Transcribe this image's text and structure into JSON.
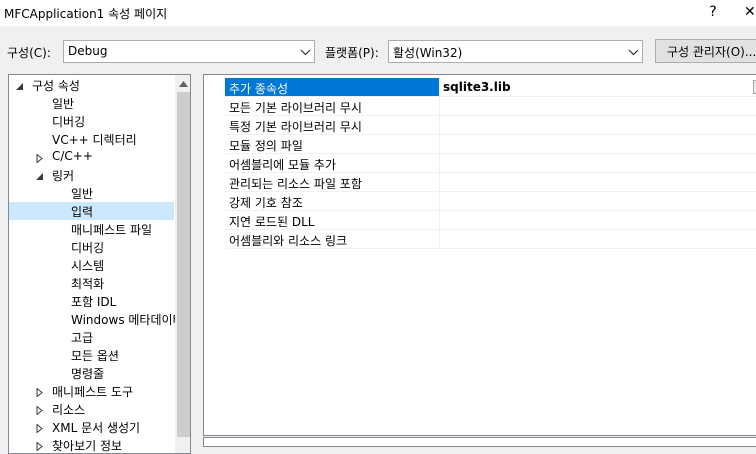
{
  "window": {
    "title": "MFCApplication1 속성 페이지",
    "help": "?",
    "close": "✕"
  },
  "toolbar": {
    "config_label": "구성(C):",
    "config_value": "Debug",
    "platform_label": "플랫폼(P):",
    "platform_value": "활성(Win32)",
    "config_manager": "구성 관리자(O)..."
  },
  "tree": [
    {
      "label": "구성 속성",
      "expander": "expanded"
    },
    {
      "label": "일반",
      "expander": "none"
    },
    {
      "label": "디버깅",
      "expander": "none"
    },
    {
      "label": "VC++ 디렉터리",
      "expander": "none"
    },
    {
      "label": "C/C++",
      "expander": "collapsed"
    },
    {
      "label": "링커",
      "expander": "expanded"
    },
    {
      "label": "일반",
      "expander": "none"
    },
    {
      "label": "입력",
      "expander": "none",
      "selected": true
    },
    {
      "label": "매니페스트 파일",
      "expander": "none"
    },
    {
      "label": "디버깅",
      "expander": "none"
    },
    {
      "label": "시스템",
      "expander": "none"
    },
    {
      "label": "최적화",
      "expander": "none"
    },
    {
      "label": "포함 IDL",
      "expander": "none"
    },
    {
      "label": "Windows 메타데이터",
      "expander": "none"
    },
    {
      "label": "고급",
      "expander": "none"
    },
    {
      "label": "모든 옵션",
      "expander": "none"
    },
    {
      "label": "명령줄",
      "expander": "none"
    },
    {
      "label": "매니페스트 도구",
      "expander": "collapsed"
    },
    {
      "label": "리소스",
      "expander": "collapsed"
    },
    {
      "label": "XML 문서 생성기",
      "expander": "collapsed"
    },
    {
      "label": "찾아보기 정보",
      "expander": "collapsed"
    }
  ],
  "properties": [
    {
      "name": "추가 종속성",
      "value": "sqlite3.lib",
      "selected": true
    },
    {
      "name": "모든 기본 라이브러리 무시",
      "value": ""
    },
    {
      "name": "특정 기본 라이브러리 무시",
      "value": ""
    },
    {
      "name": "모듈 정의 파일",
      "value": ""
    },
    {
      "name": "어셈블리에 모듈 추가",
      "value": ""
    },
    {
      "name": "관리되는 리소스 파일 포함",
      "value": ""
    },
    {
      "name": "강제 기호 참조",
      "value": ""
    },
    {
      "name": "지연 로드된 DLL",
      "value": ""
    },
    {
      "name": "어셈블리와 리소스 링크",
      "value": ""
    }
  ],
  "colors": {
    "selection": "#0078d7",
    "tree_selection": "#cce8ff",
    "dialog_bg": "#f0f0f0"
  }
}
